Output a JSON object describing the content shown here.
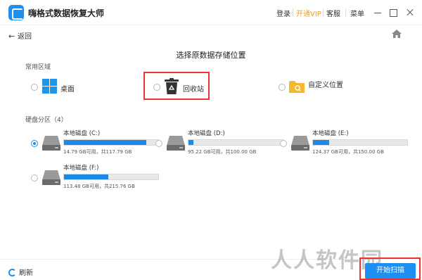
{
  "app": {
    "title": "嗨格式数据恢复大师"
  },
  "topbar": {
    "login": "登录",
    "vip": "开通VIP",
    "service": "客服",
    "menu": "菜单"
  },
  "nav": {
    "back": "返回"
  },
  "page": {
    "title": "选择原数据存储位置"
  },
  "common": {
    "label": "常用区域",
    "items": [
      {
        "label": "桌面",
        "icon": "windows-icon"
      },
      {
        "label": "回收站",
        "icon": "recycle-bin-icon"
      },
      {
        "label": "自定义位置",
        "icon": "folder-search-icon"
      }
    ]
  },
  "disks": {
    "label": "硬盘分区（4）",
    "items": [
      {
        "name": "本地磁盘 (C:)",
        "info": "14.79 GB可用，共117.79 GB",
        "used_fraction": 0.87,
        "selected": true
      },
      {
        "name": "本地磁盘 (D:)",
        "info": "95.22 GB可用，共100.00 GB",
        "used_fraction": 0.05,
        "selected": false
      },
      {
        "name": "本地磁盘 (E:)",
        "info": "124.37 GB可用，共150.00 GB",
        "used_fraction": 0.17,
        "selected": false
      },
      {
        "name": "本地磁盘 (F:)",
        "info": "113.48 GB可用，共215.76 GB",
        "used_fraction": 0.47,
        "selected": false
      }
    ]
  },
  "footer": {
    "refresh": "刷新",
    "start": "开始扫描",
    "watermark": "人人软件园"
  },
  "colors": {
    "accent": "#1d8ff0",
    "vip": "#f0a020",
    "highlight": "#e33333"
  }
}
